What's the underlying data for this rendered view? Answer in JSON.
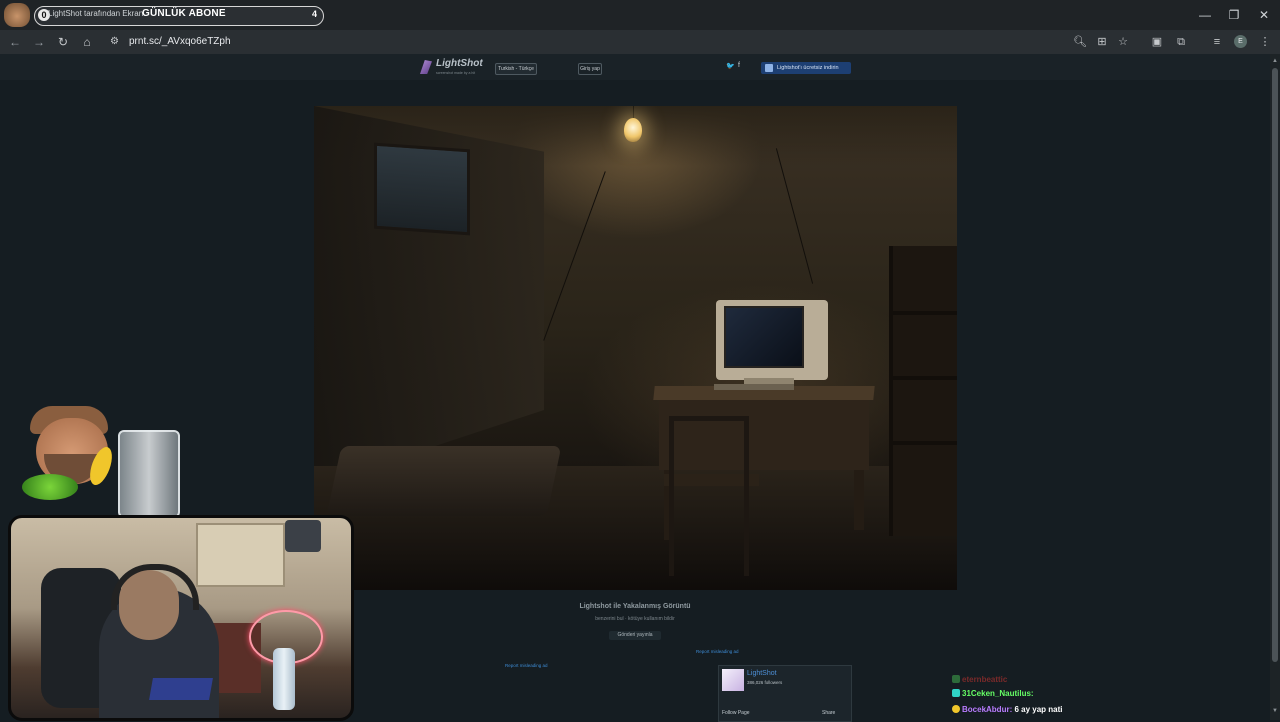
{
  "browser": {
    "tab": {
      "count": "0",
      "title": "LightShot tarafından Ekran",
      "badge": "GÜNLÜK ABONE",
      "number": "4"
    },
    "window_controls": {
      "minimize": "—",
      "maximize": "❐",
      "close": "✕"
    },
    "nav": {
      "back": "←",
      "forward": "→",
      "reload": "↻",
      "home": "⌂"
    },
    "url": "prnt.sc/_AVxqo6eTZph",
    "profile_initial": "E",
    "toolbar_icons": [
      "zoom-icon",
      "install-app-icon",
      "bookmark-star-icon",
      "tab-search-icon",
      "extensions-icon",
      "media-control-icon",
      "profile-icon",
      "more-menu-icon"
    ]
  },
  "site": {
    "logo_text": "LightShot",
    "logo_sub": "screenshot made by a hit",
    "language": "Turkish - Türkçe",
    "login": "Giriş yap",
    "social_twitter": "🐦",
    "social_facebook": "f",
    "install_button": "Lightshot'ı ücretsiz indirin",
    "image_title": "Lightshot ile Yakalanmış Görüntü",
    "image_meta": "benzerini bul · kötüye kullanım bildir",
    "tweet_button": "Gönderi yayınla",
    "report_ad_left": "Report misleading ad",
    "report_ad_right": "Report misleading ad",
    "fb_widget": {
      "name": "LightShot",
      "followers": "386,026 followers",
      "follow_page": "Follow Page",
      "share": "Share"
    }
  },
  "chat": [
    {
      "user": "eternbeattic",
      "message": "",
      "color": "#7a2a2a"
    },
    {
      "user": "31Ceken_Nautilus:",
      "message": "",
      "color": "#66ff66"
    },
    {
      "user": "BocekAbdur:",
      "message": "6 ay yap nati",
      "color": "#b97cff"
    }
  ]
}
